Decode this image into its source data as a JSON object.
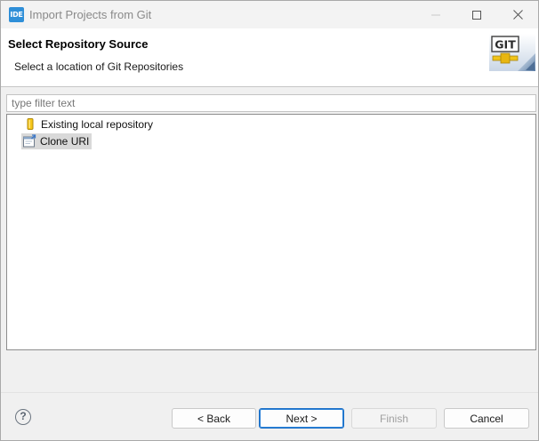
{
  "window": {
    "icon_text": "IDE",
    "title": "Import Projects from Git"
  },
  "header": {
    "title": "Select Repository Source",
    "description": "Select a location of Git Repositories",
    "logo_text": "GIT"
  },
  "filter": {
    "placeholder": "type filter text",
    "value": ""
  },
  "tree": {
    "items": [
      {
        "label": "Existing local repository",
        "icon": "repository-icon",
        "selected": false
      },
      {
        "label": "Clone URI",
        "icon": "clone-uri-icon",
        "selected": true
      }
    ]
  },
  "buttons": {
    "help": "?",
    "back": "< Back",
    "next": "Next >",
    "finish": "Finish",
    "cancel": "Cancel"
  },
  "colors": {
    "accent": "#1b6fc6",
    "selection": "#d9d9d9"
  }
}
